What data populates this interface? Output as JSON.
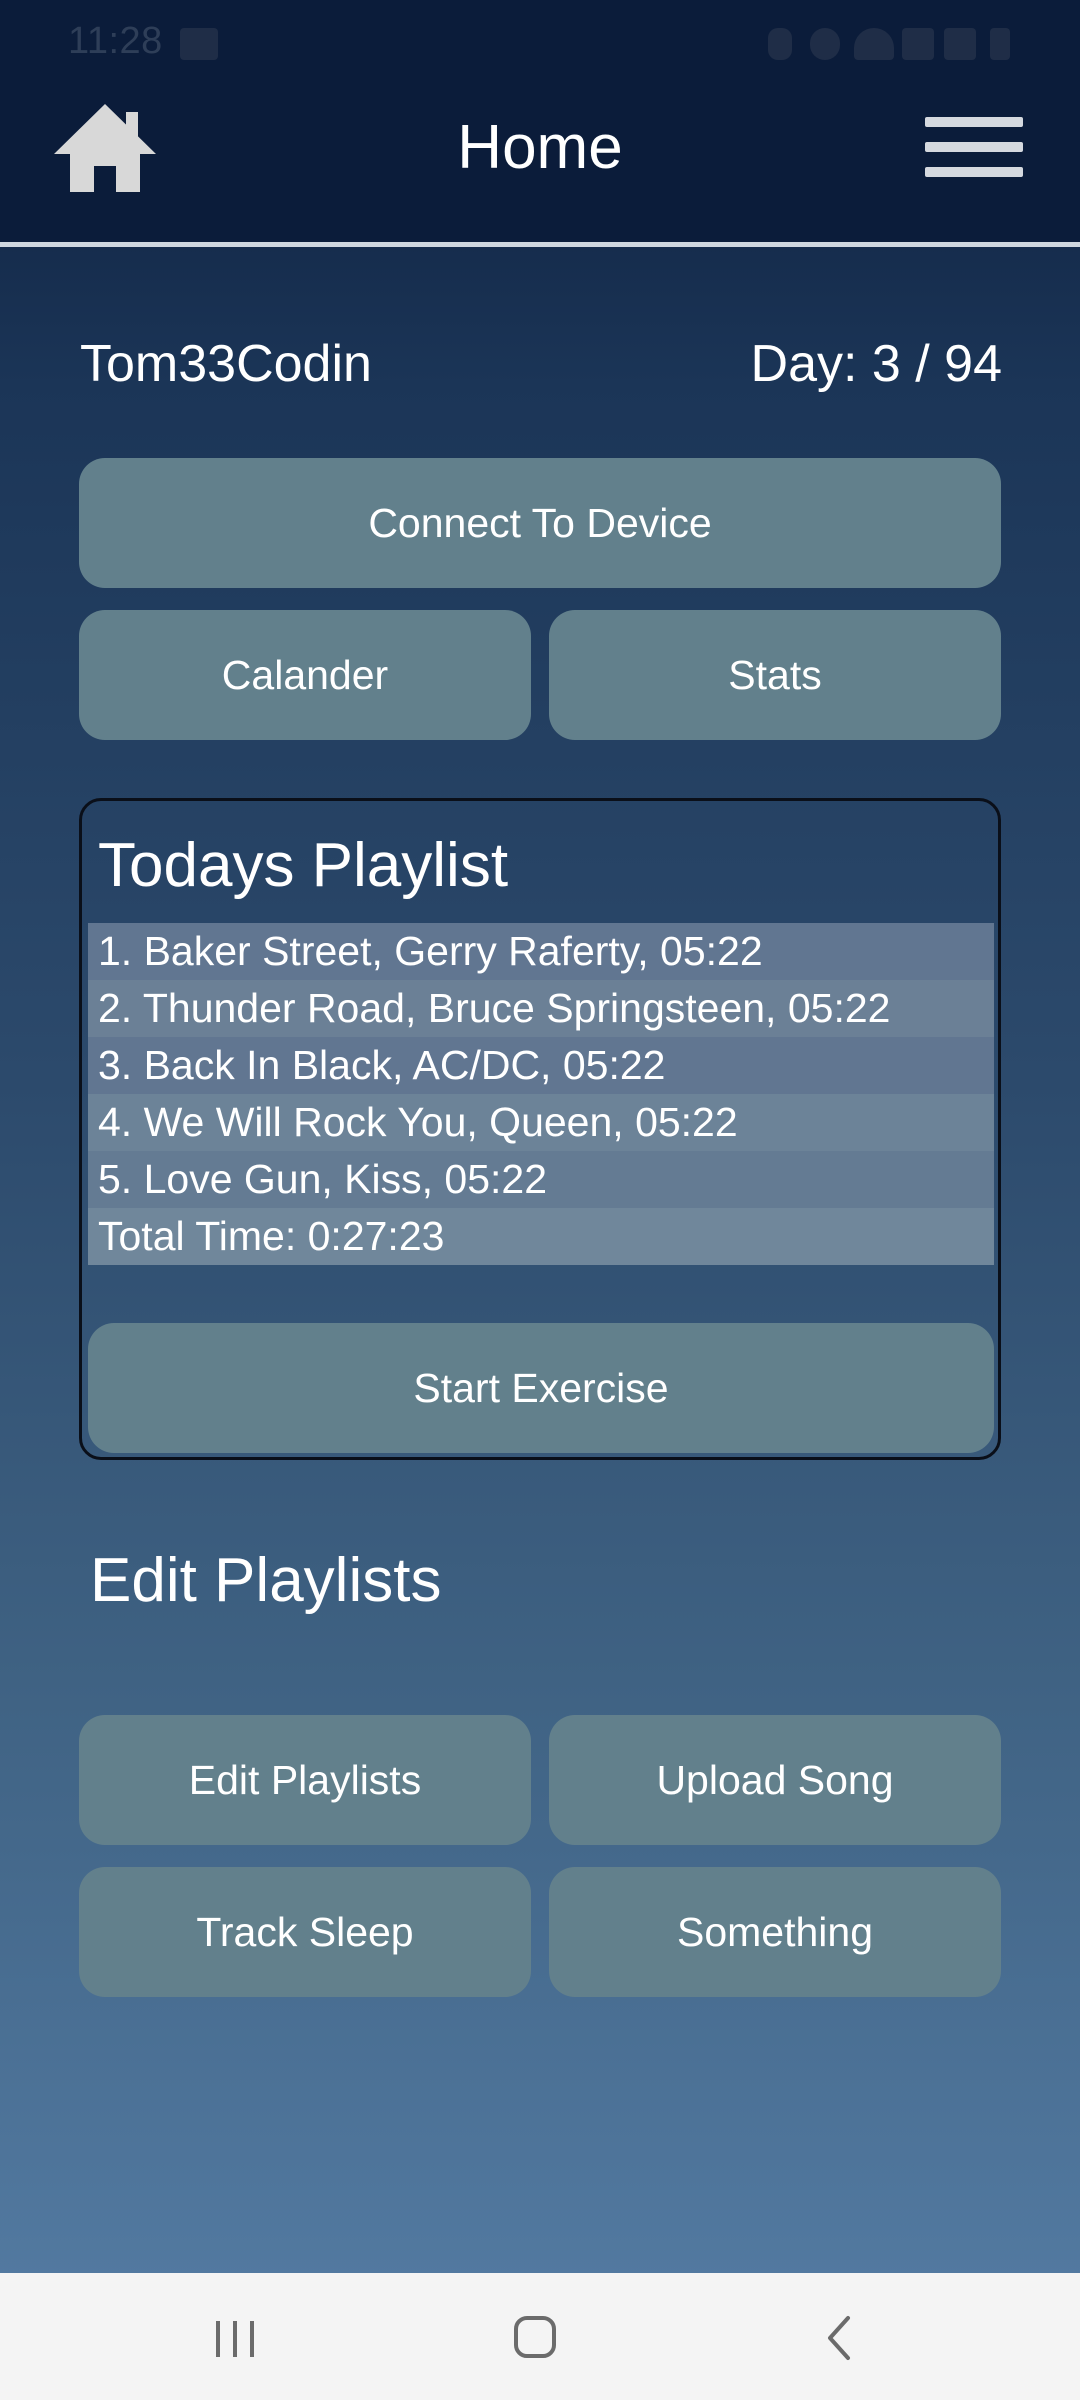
{
  "status_bar": {
    "time": "11:28"
  },
  "app_bar": {
    "title": "Home",
    "home_icon": "home-icon",
    "menu_icon": "hamburger-menu-icon"
  },
  "user": {
    "username": "Tom33Codin",
    "day": "Day: 3 / 94"
  },
  "buttons": {
    "connect": "Connect To Device",
    "calander": "Calander",
    "stats": "Stats"
  },
  "playlist": {
    "title": "Todays Playlist",
    "tracks": [
      "1. Baker Street, Gerry Raferty, 05:22",
      "2. Thunder Road, Bruce Springsteen, 05:22",
      "3. Back In Black, AC/DC, 05:22",
      "4. We Will Rock You, Queen, 05:22",
      "5. Love Gun, Kiss, 05:22"
    ],
    "total": "Total Time: 0:27:23",
    "start_button": "Start Exercise"
  },
  "edit_section": {
    "title": "Edit Playlists",
    "buttons": [
      "Edit Playlists",
      "Upload Song",
      "Track Sleep",
      "Something"
    ]
  },
  "colors": {
    "app_bar": "#0b1c3a",
    "button": "#62808c",
    "row_light": "#6c8196",
    "row_dark": "#617691"
  }
}
